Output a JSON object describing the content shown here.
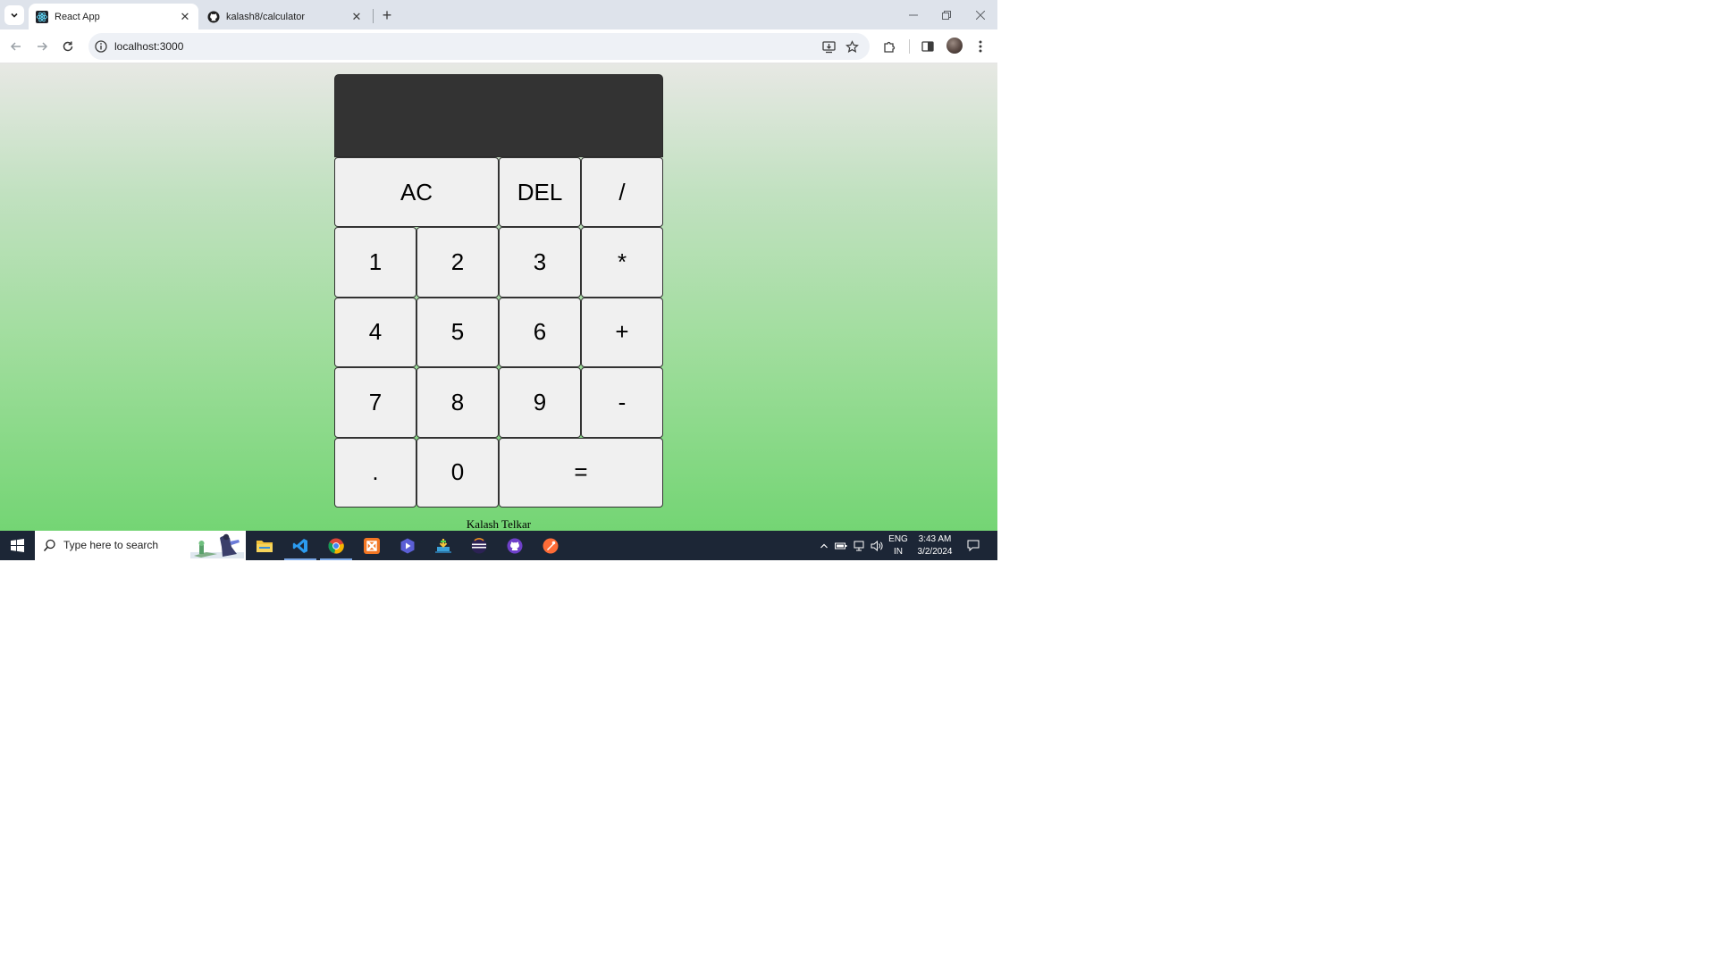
{
  "browser": {
    "tabs": [
      {
        "title": "React App",
        "favicon": "react-icon",
        "active": true
      },
      {
        "title": "kalash8/calculator",
        "favicon": "github-icon",
        "active": false
      }
    ],
    "address": "localhost:3000"
  },
  "calculator": {
    "display": "",
    "keys": [
      {
        "label": "AC",
        "span": 2
      },
      {
        "label": "DEL",
        "span": 1
      },
      {
        "label": "/",
        "span": 1
      },
      {
        "label": "1",
        "span": 1
      },
      {
        "label": "2",
        "span": 1
      },
      {
        "label": "3",
        "span": 1
      },
      {
        "label": "*",
        "span": 1
      },
      {
        "label": "4",
        "span": 1
      },
      {
        "label": "5",
        "span": 1
      },
      {
        "label": "6",
        "span": 1
      },
      {
        "label": "+",
        "span": 1
      },
      {
        "label": "7",
        "span": 1
      },
      {
        "label": "8",
        "span": 1
      },
      {
        "label": "9",
        "span": 1
      },
      {
        "label": "-",
        "span": 1
      },
      {
        "label": ".",
        "span": 1
      },
      {
        "label": "0",
        "span": 1
      },
      {
        "label": "=",
        "span": 2
      }
    ],
    "footer": "Kalash Telkar"
  },
  "taskbar": {
    "search_placeholder": "Type here to search",
    "apps": [
      "file-explorer-icon",
      "vscode-icon",
      "chrome-icon",
      "xampp-icon",
      "video-app-icon",
      "installer-icon",
      "eclipse-icon",
      "github-desktop-icon",
      "postman-icon"
    ],
    "language": "ENG",
    "region": "IN",
    "time": "3:43 AM",
    "date": "3/2/2024"
  },
  "colors": {
    "display_bg": "#333333",
    "key_bg": "#f0f0f0",
    "gradient_top": "#e7e8e4",
    "gradient_bottom": "#74d574",
    "taskbar_bg": "#1c2636"
  }
}
